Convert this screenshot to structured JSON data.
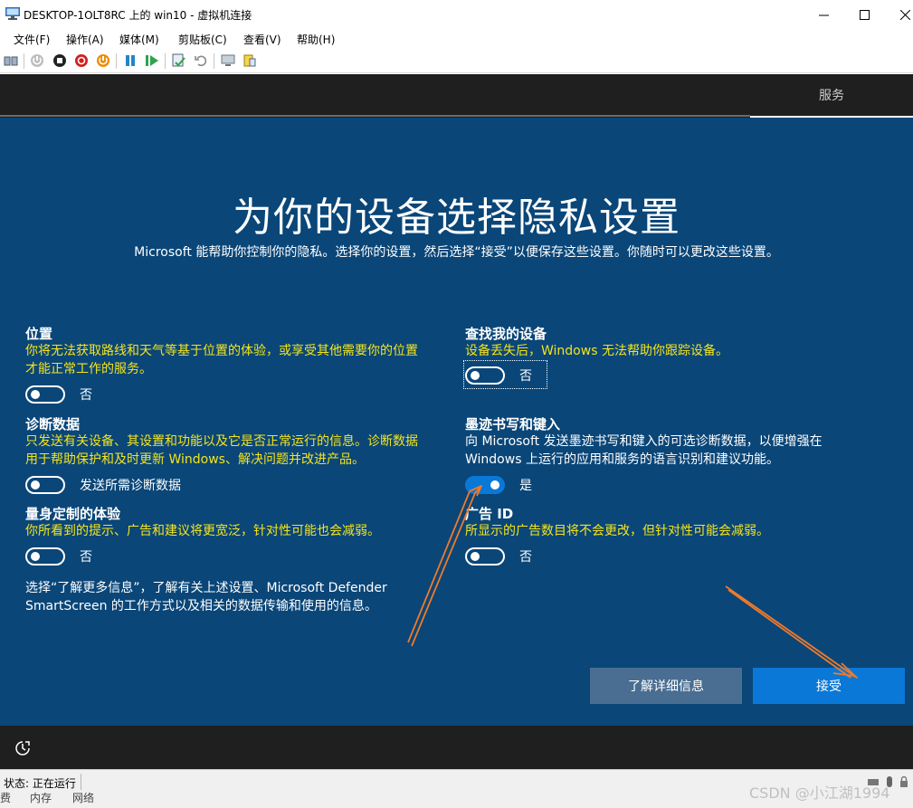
{
  "window": {
    "title": "DESKTOP-1OLT8RC 上的 win10 - 虚拟机连接",
    "icon": "vm-connection-icon"
  },
  "menubar": {
    "items": [
      "文件(F)",
      "操作(A)",
      "媒体(M)",
      "剪贴板(C)",
      "查看(V)",
      "帮助(H)"
    ]
  },
  "toolbar": {
    "icons": [
      "ctrl-alt-del-icon",
      "start-icon",
      "turn-off-icon",
      "shutdown-icon",
      "save-state-icon",
      "pause-icon",
      "resume-icon",
      "checkpoint-icon",
      "revert-icon",
      "enhanced-session-icon",
      "share-icon"
    ]
  },
  "vm_header": {
    "tab": "服务"
  },
  "oobe": {
    "heading": "为你的设备选择隐私设置",
    "subtitle": "Microsoft 能帮助你控制你的隐私。选择你的设置，然后选择“接受”以便保存这些设置。你随时可以更改这些设置。",
    "settings_left": [
      {
        "title": "位置",
        "desc_line1": "你将无法获取路线和天气等基于位置的体验，或享受其他需要你的位置",
        "desc_line2": "才能正常工作的服务。",
        "toggle_label": "否",
        "on": false
      },
      {
        "title": "诊断数据",
        "desc_line1": "只发送有关设备、其设置和功能以及它是否正常运行的信息。诊断数据",
        "desc_line2": "用于帮助保护和及时更新 Windows、解决问题并改进产品。",
        "toggle_label": "发送所需诊断数据",
        "on": false
      },
      {
        "title": "量身定制的体验",
        "desc_line1": "你所看到的提示、广告和建议将更宽泛，针对性可能也会减弱。",
        "desc_line2": "",
        "toggle_label": "否",
        "on": false
      }
    ],
    "settings_right": [
      {
        "title": "查找我的设备",
        "desc_line1": "设备丢失后，Windows 无法帮助你跟踪设备。",
        "desc_line2": "",
        "toggle_label": "否",
        "on": false
      },
      {
        "title": "墨迹书写和键入",
        "desc_line1": "向 Microsoft 发送墨迹书写和键入的可选诊断数据，以便增强在",
        "desc_line2": "Windows 上运行的应用和服务的语言识别和建议功能。",
        "toggle_label": "是",
        "on": true
      },
      {
        "title": "广告 ID",
        "desc_line1": "所显示的广告数目将不会更改，但针对性可能会减弱。",
        "desc_line2": "",
        "toggle_label": "否",
        "on": false
      }
    ],
    "info_line1": "选择“了解更多信息”，了解有关上述设置、Microsoft Defender",
    "info_line2": "SmartScreen 的工作方式以及相关的数据传输和使用的信息。",
    "learn_more_button": "了解详细信息",
    "accept_button": "接受"
  },
  "statusbar": {
    "status": "状态: 正在运行",
    "cut_items": [
      "费",
      "内存",
      "网络"
    ],
    "watermark": "CSDN @小江湖1994"
  },
  "colors": {
    "oobe_background": "#0a4678",
    "accent": "#0a78d7",
    "description_highlight": "#f4e41c",
    "annotation_arrow": "#f07a2a"
  }
}
